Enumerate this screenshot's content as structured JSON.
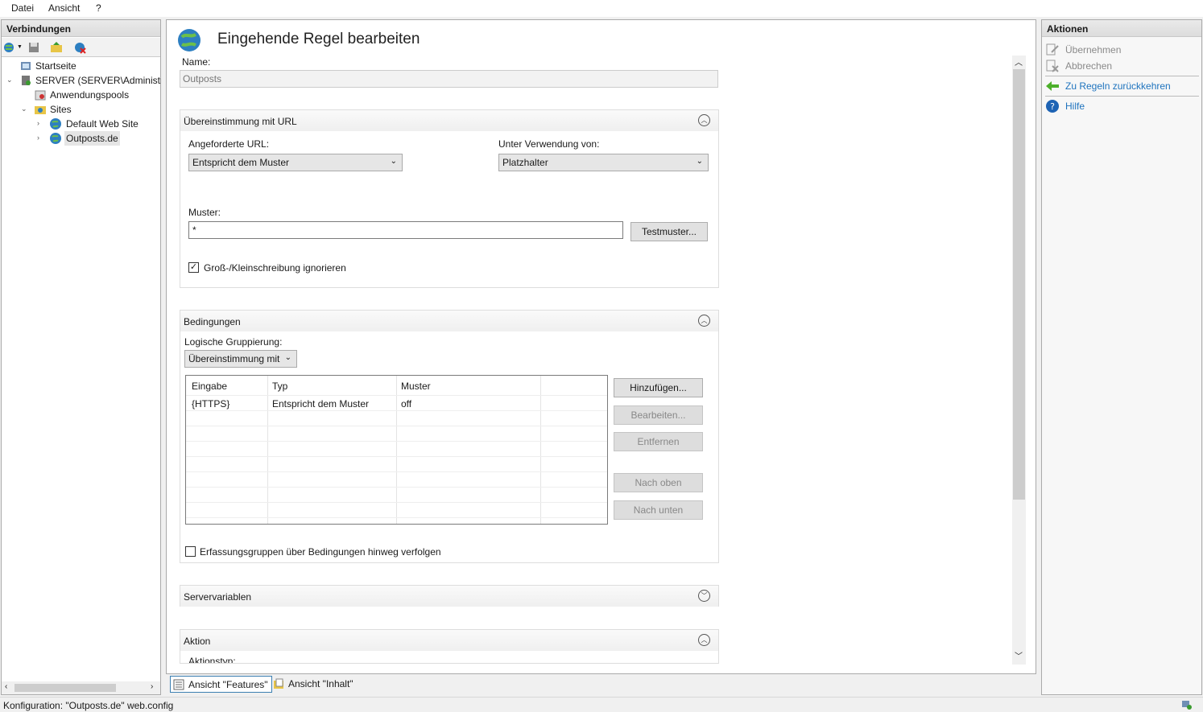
{
  "menubar": {
    "items": [
      "Datei",
      "Ansicht",
      "?"
    ]
  },
  "connections": {
    "title": "Verbindungen",
    "tree": [
      {
        "label": "Startseite",
        "icon": "home-page-icon"
      },
      {
        "label": "SERVER (SERVER\\Administrator)",
        "icon": "server-icon"
      },
      {
        "label": "Anwendungspools",
        "icon": "app-pools-icon"
      },
      {
        "label": "Sites",
        "icon": "sites-folder-icon"
      },
      {
        "label": "Default Web Site",
        "icon": "globe-icon"
      },
      {
        "label": "Outposts.de",
        "icon": "globe-icon"
      }
    ]
  },
  "main": {
    "title": "Eingehende Regel bearbeiten",
    "name_label": "Name:",
    "name_value": "Outposts",
    "url_section": {
      "title": "Übereinstimmung mit URL",
      "requested_url_label": "Angeforderte URL:",
      "requested_url_value": "Entspricht dem Muster",
      "using_label": "Unter Verwendung von:",
      "using_value": "Platzhalter",
      "pattern_label": "Muster:",
      "pattern_value": "*",
      "test_button": "Testmuster...",
      "ignore_case_label": "Groß-/Kleinschreibung ignorieren",
      "ignore_case_checked": true
    },
    "conditions_section": {
      "title": "Bedingungen",
      "grouping_label": "Logische Gruppierung:",
      "grouping_value": "Übereinstimmung mit",
      "columns": [
        "Eingabe",
        "Typ",
        "Muster"
      ],
      "rows": [
        [
          "{HTTPS}",
          "Entspricht dem Muster",
          "off"
        ]
      ],
      "buttons": {
        "add": "Hinzufügen...",
        "edit": "Bearbeiten...",
        "remove": "Entfernen",
        "up": "Nach oben",
        "down": "Nach unten"
      },
      "track_groups_label": "Erfassungsgruppen über Bedingungen hinweg verfolgen",
      "track_groups_checked": false
    },
    "server_vars_section": {
      "title": "Servervariablen"
    },
    "action_section": {
      "title": "Aktion",
      "action_type_label": "Aktionstyp:"
    }
  },
  "actions_panel": {
    "title": "Aktionen",
    "items": [
      {
        "label": "Übernehmen",
        "enabled": false,
        "icon": "apply-icon"
      },
      {
        "label": "Abbrechen",
        "enabled": false,
        "icon": "cancel-icon"
      },
      {
        "label": "Zu Regeln zurückkehren",
        "enabled": true,
        "icon": "back-arrow-icon"
      },
      {
        "label": "Hilfe",
        "enabled": true,
        "icon": "help-icon"
      }
    ]
  },
  "view_tabs": [
    "Ansicht \"Features\"",
    "Ansicht \"Inhalt\""
  ],
  "status": {
    "text": "Konfiguration: \"Outposts.de\" web.config"
  },
  "colors": {
    "link": "#1e73be",
    "disabled": "#8a8a8a",
    "accent_green": "#4caf2a"
  }
}
